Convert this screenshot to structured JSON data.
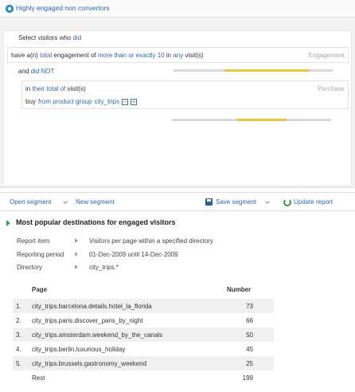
{
  "segment": {
    "title": "Highly engaged non convertors",
    "select_prefix": "Select visitors who",
    "select_who": "did",
    "cond1": {
      "t1": "have a(n)",
      "t2": "total",
      "t3": "engagement",
      "t4": "of",
      "t5": "more than or exactly",
      "t6": "10",
      "t7": "in",
      "t8": "any",
      "t9": "visit(s)",
      "tag": "Engagement"
    },
    "and_label": "and",
    "and_did_not": "did NOT",
    "cond2": {
      "t1": "in",
      "t2": "their total",
      "t3": "of",
      "t4": "visit(s)",
      "tag": "Purchase",
      "l2_t1": "buy",
      "l2_t2": "from product group",
      "l2_t3": "city_trips",
      "minus": "−",
      "plus": "+"
    }
  },
  "toolbar": {
    "open_segment": "Open segment",
    "new_segment": "New segment",
    "save_segment": "Save segment",
    "update_report": "Update report"
  },
  "report": {
    "title": "Most popular destinations for engaged visitors",
    "meta": [
      {
        "label": "Report item",
        "value": "Visitors per page within a specified directory"
      },
      {
        "label": "Reporting period",
        "value": "01-Dec-2009 until 14-Dec-2009"
      },
      {
        "label": "Directory",
        "value": "city_trips.*"
      }
    ],
    "columns": {
      "page": "Page",
      "number": "Number"
    },
    "rows": [
      {
        "idx": "1.",
        "page": "city_trips.barcelona.details.hotel_la_florida",
        "number": "73"
      },
      {
        "idx": "2.",
        "page": "city_trips.paris.discover_paris_by_night",
        "number": "66"
      },
      {
        "idx": "3.",
        "page": "city_trips.amsterdam.weekend_by_the_canals",
        "number": "50"
      },
      {
        "idx": "4.",
        "page": "city_trips.berlin.luxurious_holiday",
        "number": "45"
      },
      {
        "idx": "5.",
        "page": "city_trips.brussels.gastronomy_weekend",
        "number": "25"
      }
    ],
    "rest": {
      "label": "Rest",
      "number": "199"
    }
  },
  "colors": {
    "link": "#3366aa",
    "bar_yellow": "#f0c33c",
    "bar_gray": "#d9d9d9",
    "report_marker": "#3aa43a"
  }
}
